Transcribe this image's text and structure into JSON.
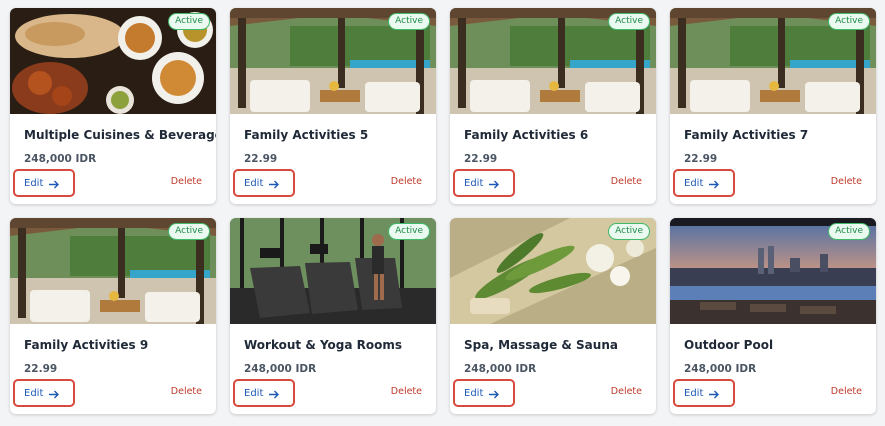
{
  "cards": [
    {
      "image": "food-dishes-image",
      "status": "Active",
      "title": "Multiple Cuisines & Beverages",
      "price": "248,000 IDR",
      "edit_label": "Edit",
      "delete_label": "Delete"
    },
    {
      "image": "pool-pavilion-image",
      "status": "Active",
      "title": "Family Activities 5",
      "price": "22.99",
      "edit_label": "Edit",
      "delete_label": "Delete"
    },
    {
      "image": "pool-pavilion-image",
      "status": "Active",
      "title": "Family Activities 6",
      "price": "22.99",
      "edit_label": "Edit",
      "delete_label": "Delete"
    },
    {
      "image": "pool-pavilion-image",
      "status": "Active",
      "title": "Family Activities 7",
      "price": "22.99",
      "edit_label": "Edit",
      "delete_label": "Delete"
    },
    {
      "image": "pool-pavilion-image",
      "status": "Active",
      "title": "Family Activities 9",
      "price": "22.99",
      "edit_label": "Edit",
      "delete_label": "Delete"
    },
    {
      "image": "gym-treadmill-image",
      "status": "Active",
      "title": "Workout & Yoga Rooms",
      "price": "248,000 IDR",
      "edit_label": "Edit",
      "delete_label": "Delete"
    },
    {
      "image": "spa-herbs-image",
      "status": "Active",
      "title": "Spa, Massage & Sauna",
      "price": "248,000 IDR",
      "edit_label": "Edit",
      "delete_label": "Delete"
    },
    {
      "image": "rooftop-pool-image",
      "status": "Active",
      "title": "Outdoor Pool",
      "price": "248,000 IDR",
      "edit_label": "Edit",
      "delete_label": "Delete"
    }
  ],
  "colors": {
    "badge_border": "#42b96a",
    "badge_text": "#1f8a49",
    "edit_text": "#1e5ab4",
    "edit_highlight": "#d84a3d",
    "delete_text": "#c0392b"
  }
}
